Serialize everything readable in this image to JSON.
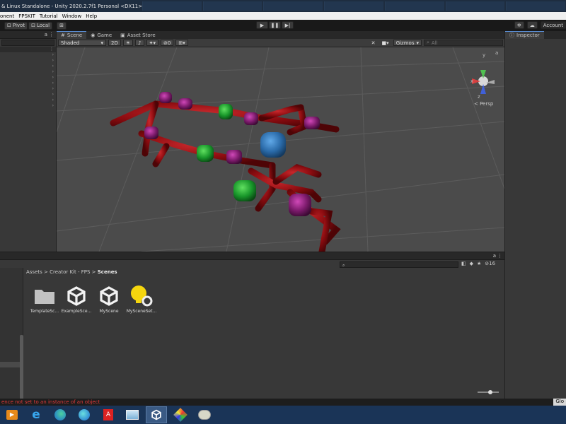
{
  "window": {
    "title": "& Linux Standalone - Unity 2020.2.7f1 Personal <DX11>"
  },
  "menu": [
    "onent",
    "FPSKIT",
    "Tutorial",
    "Window",
    "Help"
  ],
  "toolbar": {
    "pivot_label": "Pivot",
    "local_label": "Local",
    "account_label": "Account"
  },
  "scene": {
    "tabs": [
      {
        "label": "Scene",
        "icon": "grid-icon"
      },
      {
        "label": "Game",
        "icon": "gamepad-icon"
      },
      {
        "label": "Asset Store",
        "icon": "store-icon"
      }
    ],
    "shading_mode": "Shaded",
    "mode_2d": "2D",
    "hidden_count": "0",
    "gizmos_label": "Gizmos",
    "search_placeholder": "All",
    "gizmo_axes": {
      "x": "x",
      "y": "y",
      "z": "z"
    },
    "persp_label": "< Persp"
  },
  "inspector": {
    "title": "Inspector"
  },
  "project": {
    "breadcrumb": {
      "part1": "Assets",
      "sep": ">",
      "part2": "Creator Kit - FPS",
      "part3": "Scenes"
    },
    "visible_count": "16",
    "assets": [
      {
        "label": "TemplateSc...",
        "icon": "folder-icon"
      },
      {
        "label": "ExampleSce...",
        "icon": "unity-scene-icon"
      },
      {
        "label": "MyScene",
        "icon": "unity-scene-icon"
      },
      {
        "label": "MySceneSet...",
        "icon": "lighting-settings-icon"
      }
    ]
  },
  "status": {
    "message": "ence not set to an instance of an object",
    "right_label": "Glo"
  }
}
